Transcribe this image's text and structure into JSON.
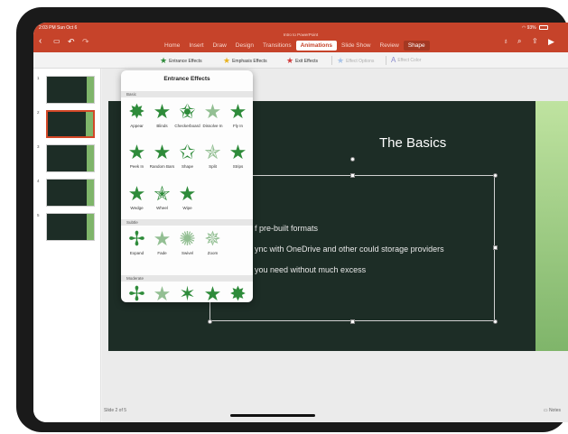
{
  "status": {
    "time": "2:03 PM  Sun Oct 6",
    "battery": "93%"
  },
  "document": {
    "title": "Intro to PowerPoint"
  },
  "tabs": [
    {
      "label": "Home"
    },
    {
      "label": "Insert"
    },
    {
      "label": "Draw"
    },
    {
      "label": "Design"
    },
    {
      "label": "Transitions"
    },
    {
      "label": "Animations"
    },
    {
      "label": "Slide Show"
    },
    {
      "label": "Review"
    },
    {
      "label": "Shape"
    }
  ],
  "ribbon": {
    "entrance": "Entrance Effects",
    "emphasis": "Emphasis Effects",
    "exit": "Exit Effects",
    "effect_options": "Effect Options",
    "effect_color": "Effect Color"
  },
  "colors": {
    "accent": "#c6432a",
    "entrance_star": "#2e8b3a",
    "emphasis_star": "#e8b21f",
    "exit_star": "#d23a3a"
  },
  "popover": {
    "title": "Entrance Effects",
    "sections": {
      "basic": "Basic",
      "subtle": "Subtle",
      "moderate": "Moderate"
    },
    "basic_effects": [
      "Appear",
      "Blinds",
      "Checkerboard",
      "Dissolve In",
      "Fly In",
      "Peek In",
      "Random Bars",
      "Shape",
      "Split",
      "Strips",
      "Wedge",
      "Wheel",
      "Wipe"
    ],
    "subtle_effects": [
      "Expand",
      "Fade",
      "Swivel",
      "Zoom"
    ]
  },
  "thumbnails": [
    "1",
    "2",
    "3",
    "4",
    "5"
  ],
  "slide": {
    "title": "The Basics",
    "bullets": [
      "f pre-built formats",
      "ync with OneDrive and other could storage providers",
      "you need without much excess"
    ]
  },
  "footer": {
    "slide_count": "Slide 2 of 5",
    "notes": "Notes"
  }
}
